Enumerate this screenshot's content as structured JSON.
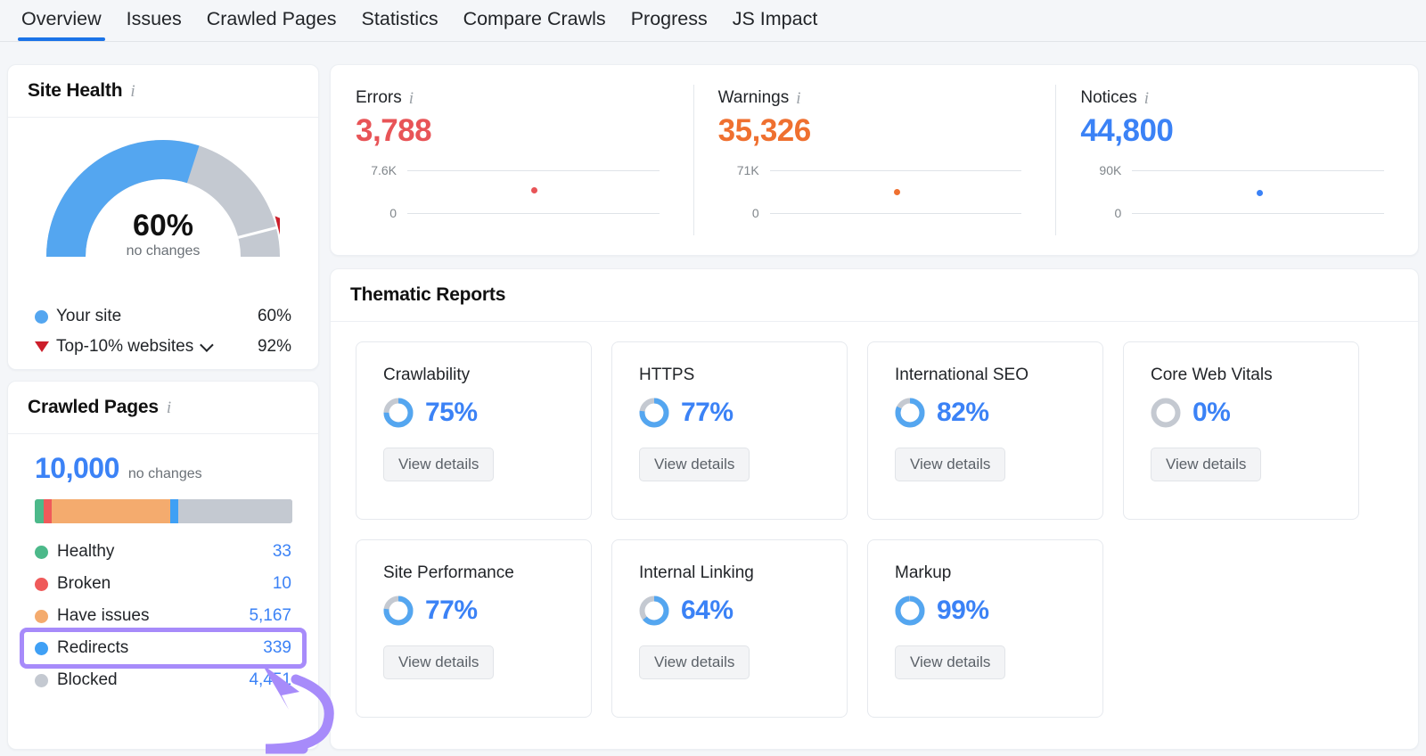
{
  "tabs": [
    {
      "label": "Overview",
      "active": true
    },
    {
      "label": "Issues",
      "active": false
    },
    {
      "label": "Crawled Pages",
      "active": false
    },
    {
      "label": "Statistics",
      "active": false
    },
    {
      "label": "Compare Crawls",
      "active": false
    },
    {
      "label": "Progress",
      "active": false
    },
    {
      "label": "JS Impact",
      "active": false
    }
  ],
  "site_health": {
    "title": "Site Health",
    "info_icon": "info-icon",
    "percent_label": "60%",
    "change_label": "no changes",
    "gauge_value": 60,
    "benchmark_value": 92,
    "legend": [
      {
        "marker": "circle",
        "color": "#54a6f0",
        "label": "Your site",
        "value": "60%"
      },
      {
        "marker": "triangle-down",
        "color": "#cc1f2b",
        "label": "Top-10% websites",
        "value": "92%",
        "has_dropdown": true
      }
    ]
  },
  "crawled_pages": {
    "title": "Crawled Pages",
    "info_icon": "info-icon",
    "total": "10,000",
    "change_label": "no changes",
    "bar_segments": [
      {
        "color": "#4cb98a",
        "pct": 3.6
      },
      {
        "color": "#ef5a5a",
        "pct": 3.1
      },
      {
        "color": "#f4ab6e",
        "pct": 46.0
      },
      {
        "color": "#3fa0f5",
        "pct": 2.9
      },
      {
        "color": "#c4c9d1",
        "pct": 44.4
      }
    ],
    "rows": [
      {
        "color": "#4cb98a",
        "label": "Healthy",
        "value": "33",
        "highlighted": false
      },
      {
        "color": "#ef5a5a",
        "label": "Broken",
        "value": "10",
        "highlighted": false
      },
      {
        "color": "#f4ab6e",
        "label": "Have issues",
        "value": "5,167",
        "highlighted": false
      },
      {
        "color": "#3fa0f5",
        "label": "Redirects",
        "value": "339",
        "highlighted": true
      },
      {
        "color": "#c4c9d1",
        "label": "Blocked",
        "value": "4,451",
        "highlighted": false
      }
    ]
  },
  "issue_summary": [
    {
      "label": "Errors",
      "info_icon": "info-icon",
      "value": "3,788",
      "color": "#e85457",
      "axis_top": "7.6K",
      "axis_bottom": "0",
      "point_x_pct": 40,
      "point_y_pct": 40
    },
    {
      "label": "Warnings",
      "info_icon": "info-icon",
      "value": "35,326",
      "color": "#ef7030",
      "axis_top": "71K",
      "axis_bottom": "0",
      "point_x_pct": 40,
      "point_y_pct": 44
    },
    {
      "label": "Notices",
      "info_icon": "info-icon",
      "value": "44,800",
      "color": "#3b82f6",
      "axis_top": "90K",
      "axis_bottom": "0",
      "point_x_pct": 40,
      "point_y_pct": 45
    }
  ],
  "thematic": {
    "title": "Thematic Reports",
    "button_label": "View details",
    "cards": [
      {
        "name": "Crawlability",
        "percent_label": "75%",
        "value": 75
      },
      {
        "name": "HTTPS",
        "percent_label": "77%",
        "value": 77
      },
      {
        "name": "International SEO",
        "percent_label": "82%",
        "value": 82
      },
      {
        "name": "Core Web Vitals",
        "percent_label": "0%",
        "value": 0
      },
      {
        "name": "Site Performance",
        "percent_label": "77%",
        "value": 77
      },
      {
        "name": "Internal Linking",
        "percent_label": "64%",
        "value": 64
      },
      {
        "name": "Markup",
        "percent_label": "99%",
        "value": 99
      }
    ]
  },
  "annotation": {
    "type": "arrow-highlight",
    "color": "#a78bfa",
    "target": "Redirects"
  },
  "colors": {
    "accent_blue": "#3b82f6",
    "tab_underline": "#1a73e8",
    "error_red": "#e85457",
    "warning_orange": "#ef7030",
    "gauge_blue": "#54a6f0",
    "gauge_gray": "#c4c9d1",
    "annotation_purple": "#a78bfa"
  }
}
